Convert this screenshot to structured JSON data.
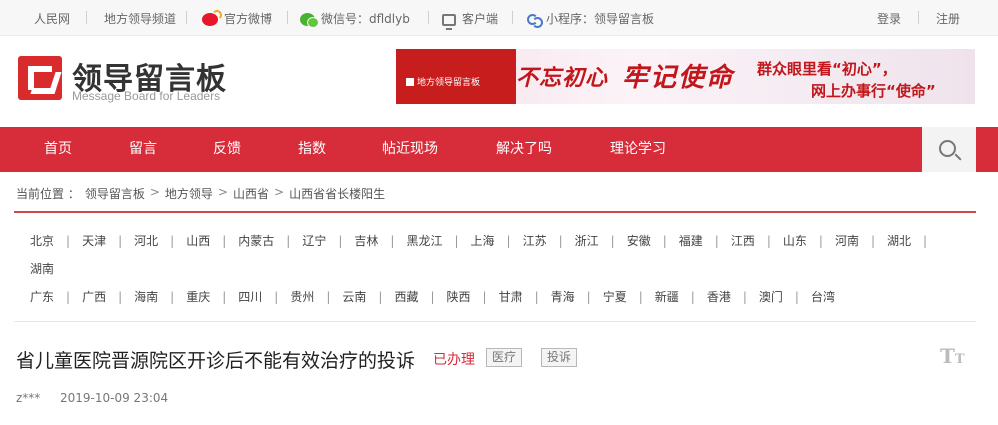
{
  "topbar": {
    "people_net": "人民网",
    "leader_channel": "地方领导频道",
    "weibo": "官方微博",
    "wechat": "微信号：dfldlyb",
    "client": "客户端",
    "mini_program": "小程序：领导留言板",
    "login": "登录",
    "register": "注册"
  },
  "header": {
    "logo_title": "领导留言板",
    "logo_subtitle": "Message Board for Leaders",
    "banner": {
      "logo_text": "地方领导留言板",
      "calligraphy_1": "不忘初心",
      "calligraphy_2": "牢记使命",
      "line1": "群众眼里看“初心”，",
      "line2": "网上办事行“使命”"
    }
  },
  "nav": {
    "items": [
      "首页",
      "留言",
      "反馈",
      "指数",
      "帖近现场",
      "解决了吗",
      "理论学习"
    ]
  },
  "breadcrumb": {
    "label": "当前位置 ：",
    "items": [
      "领导留言板",
      "地方领导",
      "山西省",
      "山西省省长楼阳生"
    ]
  },
  "provinces": {
    "row1": [
      "北京",
      "天津",
      "河北",
      "山西",
      "内蒙古",
      "辽宁",
      "吉林",
      "黑龙江",
      "上海",
      "江苏",
      "浙江",
      "安徽",
      "福建",
      "江西",
      "山东",
      "河南",
      "湖北"
    ],
    "row2": [
      "湖南"
    ],
    "row3": [
      "广东",
      "广西",
      "海南",
      "重庆",
      "四川",
      "贵州",
      "云南",
      "西藏",
      "陕西",
      "甘肃",
      "青海",
      "宁夏",
      "新疆",
      "香港",
      "澳门",
      "台湾"
    ]
  },
  "article": {
    "title": "省儿童医院晋源院区开诊后不能有效治疗的投诉",
    "status": "已办理",
    "tags": [
      "医疗",
      "投诉"
    ],
    "font_toggle_big": "T",
    "font_toggle_small": "T",
    "author": "z***",
    "date": "2019-10-09 23:04"
  },
  "colors": {
    "brand_red": "#d72c3a",
    "status_red": "#d72c3a"
  }
}
